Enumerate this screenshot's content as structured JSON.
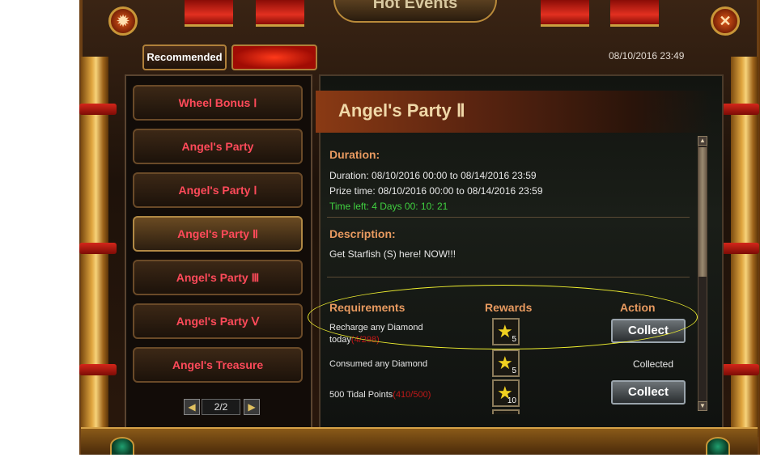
{
  "window": {
    "title": "Hot Events"
  },
  "header": {
    "settings_icon": "gear-icon",
    "close_icon": "close-icon",
    "close_glyph": "✕",
    "settings_glyph": "✹"
  },
  "tabs": [
    {
      "label": "Recommended"
    },
    {
      "label": ""
    }
  ],
  "server_time": "08/10/2016 23:49",
  "sidebar": {
    "items": [
      {
        "label": "Wheel Bonus Ⅰ"
      },
      {
        "label": "Angel's Party"
      },
      {
        "label": "Angel's Party Ⅰ"
      },
      {
        "label": "Angel's Party Ⅱ"
      },
      {
        "label": "Angel's Party Ⅲ"
      },
      {
        "label": "Angel's Party Ⅴ"
      },
      {
        "label": "Angel's Treasure"
      }
    ],
    "pager": {
      "text": "2/2",
      "prev_glyph": "◀",
      "next_glyph": "▶"
    }
  },
  "event": {
    "title": "Angel's Party Ⅱ",
    "duration_heading": "Duration:",
    "duration": "Duration: 08/10/2016 00:00 to 08/14/2016 23:59",
    "prize_time": "Prize time: 08/10/2016 00:00 to 08/14/2016 23:59",
    "time_left": "Time left: 4 Days  00: 10: 21",
    "description_heading": "Description:",
    "description": "Get Starfish (S) here! NOW!!!",
    "columns": {
      "requirements": "Requirements",
      "rewards": "Rewards",
      "action": "Action"
    },
    "rows": [
      {
        "req_line1": "Recharge any Diamond",
        "req_line2": "today",
        "progress": "(4/298)",
        "reward_icon": "star-icon",
        "reward_count": "5",
        "action": "Collect"
      },
      {
        "req_line1": "Consumed any Diamond",
        "req_line2": "",
        "progress": "",
        "reward_icon": "star-icon",
        "reward_count": "5",
        "action": "Collected"
      },
      {
        "req_line1": "500 Tidal Points",
        "req_line2": "",
        "progress": "(410/500)",
        "reward_icon": "star-icon",
        "reward_count": "10",
        "action": "Collect"
      }
    ]
  },
  "scroll": {
    "up_glyph": "▲",
    "down_glyph": "▼"
  },
  "star_glyph": "★"
}
